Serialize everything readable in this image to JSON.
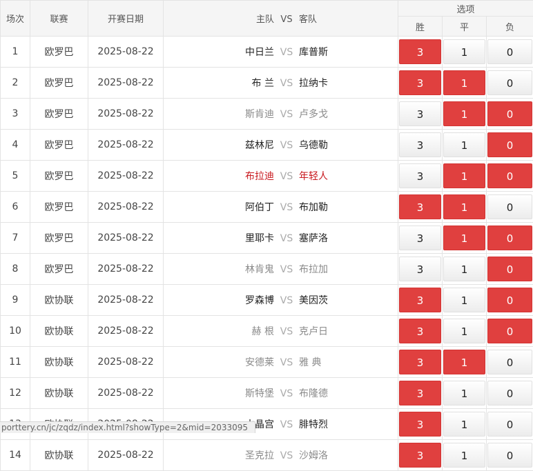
{
  "header": {
    "col_index": "场次",
    "col_league": "联赛",
    "col_date": "开赛日期",
    "col_match_home": "主队",
    "col_match_vs": "VS",
    "col_match_away": "客队",
    "col_options": "选项",
    "opt_win": "胜",
    "opt_draw": "平",
    "opt_lose": "负"
  },
  "rows": [
    {
      "n": "1",
      "league": "欧罗巴",
      "date": "2025-08-22",
      "home": "中日兰",
      "vs": "VS",
      "away": "库普斯",
      "style": "normal",
      "w": "3",
      "d": "1",
      "l": "0",
      "sw": true,
      "sd": false,
      "sl": false
    },
    {
      "n": "2",
      "league": "欧罗巴",
      "date": "2025-08-22",
      "home": "布 兰",
      "vs": "VS",
      "away": "拉纳卡",
      "style": "normal",
      "w": "3",
      "d": "1",
      "l": "0",
      "sw": true,
      "sd": true,
      "sl": false
    },
    {
      "n": "3",
      "league": "欧罗巴",
      "date": "2025-08-22",
      "home": "斯肯迪",
      "vs": "VS",
      "away": "卢多戈",
      "style": "gray",
      "w": "3",
      "d": "1",
      "l": "0",
      "sw": false,
      "sd": true,
      "sl": true
    },
    {
      "n": "4",
      "league": "欧罗巴",
      "date": "2025-08-22",
      "home": "兹林尼",
      "vs": "VS",
      "away": "乌德勒",
      "style": "normal",
      "w": "3",
      "d": "1",
      "l": "0",
      "sw": false,
      "sd": false,
      "sl": true
    },
    {
      "n": "5",
      "league": "欧罗巴",
      "date": "2025-08-22",
      "home": "布拉迪",
      "vs": "VS",
      "away": "年轻人",
      "style": "red",
      "w": "3",
      "d": "1",
      "l": "0",
      "sw": false,
      "sd": true,
      "sl": true
    },
    {
      "n": "6",
      "league": "欧罗巴",
      "date": "2025-08-22",
      "home": "阿伯丁",
      "vs": "VS",
      "away": "布加勒",
      "style": "normal",
      "w": "3",
      "d": "1",
      "l": "0",
      "sw": true,
      "sd": true,
      "sl": false
    },
    {
      "n": "7",
      "league": "欧罗巴",
      "date": "2025-08-22",
      "home": "里耶卡",
      "vs": "VS",
      "away": "塞萨洛",
      "style": "normal",
      "w": "3",
      "d": "1",
      "l": "0",
      "sw": false,
      "sd": true,
      "sl": true
    },
    {
      "n": "8",
      "league": "欧罗巴",
      "date": "2025-08-22",
      "home": "林肯鬼",
      "vs": "VS",
      "away": "布拉加",
      "style": "gray",
      "w": "3",
      "d": "1",
      "l": "0",
      "sw": false,
      "sd": false,
      "sl": true
    },
    {
      "n": "9",
      "league": "欧协联",
      "date": "2025-08-22",
      "home": "罗森博",
      "vs": "VS",
      "away": "美因茨",
      "style": "normal",
      "w": "3",
      "d": "1",
      "l": "0",
      "sw": true,
      "sd": false,
      "sl": true
    },
    {
      "n": "10",
      "league": "欧协联",
      "date": "2025-08-22",
      "home": "赫 根",
      "vs": "VS",
      "away": "克卢日",
      "style": "gray",
      "w": "3",
      "d": "1",
      "l": "0",
      "sw": true,
      "sd": false,
      "sl": true
    },
    {
      "n": "11",
      "league": "欧协联",
      "date": "2025-08-22",
      "home": "安德莱",
      "vs": "VS",
      "away": "雅 典",
      "style": "gray",
      "w": "3",
      "d": "1",
      "l": "0",
      "sw": true,
      "sd": true,
      "sl": false
    },
    {
      "n": "12",
      "league": "欧协联",
      "date": "2025-08-22",
      "home": "斯特堡",
      "vs": "VS",
      "away": "布隆德",
      "style": "gray",
      "w": "3",
      "d": "1",
      "l": "0",
      "sw": true,
      "sd": false,
      "sl": false
    },
    {
      "n": "13",
      "league": "欧协联",
      "date": "2025-08-22",
      "home": "水晶宫",
      "vs": "VS",
      "away": "腓特烈",
      "style": "normal",
      "w": "3",
      "d": "1",
      "l": "0",
      "sw": true,
      "sd": false,
      "sl": false
    },
    {
      "n": "14",
      "league": "欧协联",
      "date": "2025-08-22",
      "home": "圣克拉",
      "vs": "VS",
      "away": "沙姆洛",
      "style": "gray",
      "w": "3",
      "d": "1",
      "l": "0",
      "sw": true,
      "sd": false,
      "sl": false
    }
  ],
  "status_url": "porttery.cn/jc/zqdz/index.html?showType=2&mid=2033095",
  "colors": {
    "selected": "#e0403f",
    "gray_text": "#8a8a8a",
    "red_text": "#c8181e"
  }
}
